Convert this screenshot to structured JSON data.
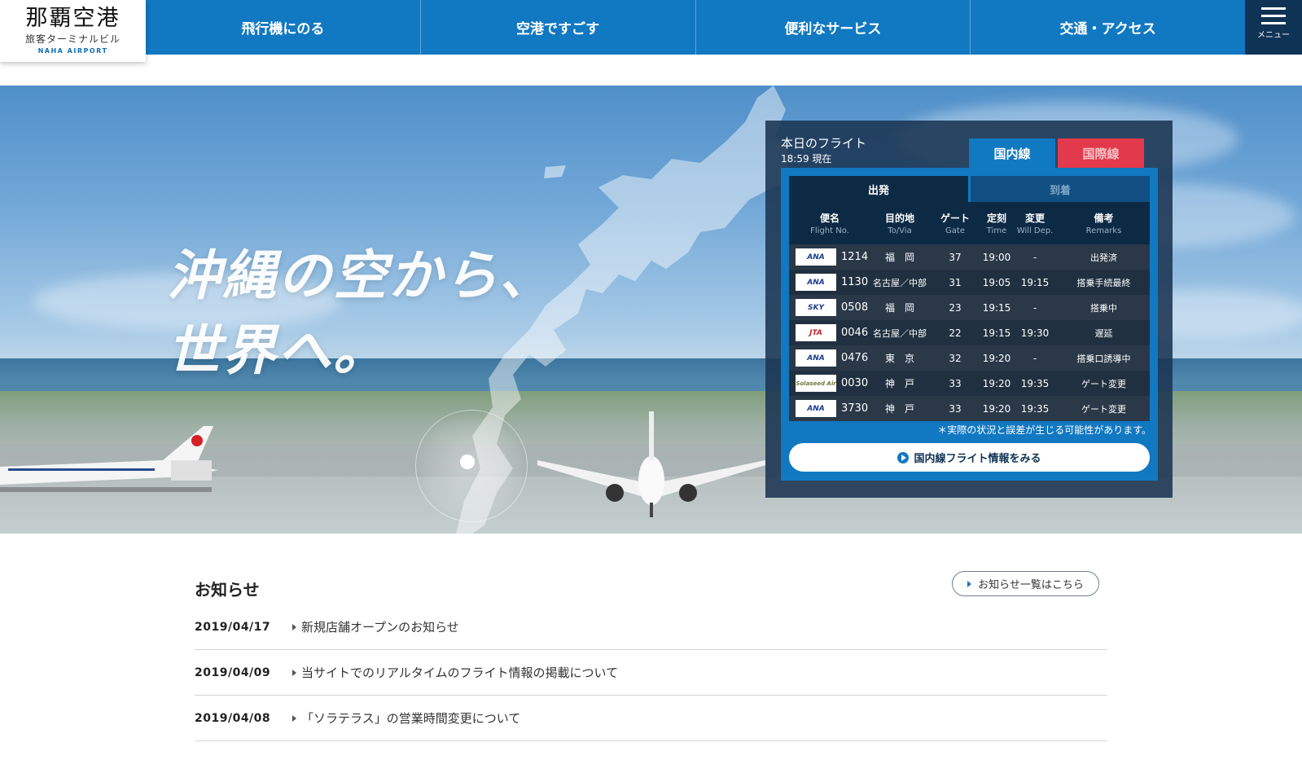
{
  "logo": {
    "main": "那覇空港",
    "sub": "旅客ターミナルビル",
    "en": "NAHA AIRPORT"
  },
  "nav": {
    "items": [
      {
        "label": "飛行機にのる"
      },
      {
        "label": "空港ですごす"
      },
      {
        "label": "便利なサービス"
      },
      {
        "label": "交通・アクセス"
      }
    ],
    "menu_label": "メニュー"
  },
  "hero": {
    "line1": "沖縄の空から、",
    "line2": "世界へ。"
  },
  "flights": {
    "title": "本日のフライト",
    "time": "18:59 現在",
    "tab_domestic": "国内線",
    "tab_international": "国際線",
    "dir_departure": "出発",
    "dir_arrival": "到着",
    "headers": [
      {
        "jp": "便名",
        "en": "Flight No."
      },
      {
        "jp": "目的地",
        "en": "To/Via"
      },
      {
        "jp": "ゲート",
        "en": "Gate"
      },
      {
        "jp": "定刻",
        "en": "Time"
      },
      {
        "jp": "変更",
        "en": "Will Dep."
      },
      {
        "jp": "備考",
        "en": "Remarks"
      }
    ],
    "rows": [
      {
        "airline": "ANA",
        "no": "1214",
        "dest": "福　岡",
        "gate": "37",
        "time": "19:00",
        "change": "-",
        "remarks": "出発済"
      },
      {
        "airline": "ANA",
        "no": "1130",
        "dest": "名古屋／中部",
        "gate": "31",
        "time": "19:05",
        "change": "19:15",
        "remarks": "搭乗手続最終"
      },
      {
        "airline": "SKY",
        "no": "0508",
        "dest": "福　岡",
        "gate": "23",
        "time": "19:15",
        "change": "-",
        "remarks": "搭乗中"
      },
      {
        "airline": "JTA",
        "no": "0046",
        "dest": "名古屋／中部",
        "gate": "22",
        "time": "19:15",
        "change": "19:30",
        "remarks": "遅延"
      },
      {
        "airline": "ANA",
        "no": "0476",
        "dest": "東　京",
        "gate": "32",
        "time": "19:20",
        "change": "-",
        "remarks": "搭乗口誘導中"
      },
      {
        "airline": "Solaseed Air",
        "no": "0030",
        "dest": "神　戸",
        "gate": "33",
        "time": "19:20",
        "change": "19:35",
        "remarks": "ゲート変更"
      },
      {
        "airline": "ANA",
        "no": "3730",
        "dest": "神　戸",
        "gate": "33",
        "time": "19:20",
        "change": "19:35",
        "remarks": "ゲート変更"
      }
    ],
    "note": "＊実際の状況と誤差が生じる可能性があります。",
    "button": "国内線フライト情報をみる"
  },
  "news": {
    "title": "お知らせ",
    "more": "お知らせ一覧はこちら",
    "items": [
      {
        "date": "2019/04/17",
        "text": "新規店舗オープンのお知らせ"
      },
      {
        "date": "2019/04/09",
        "text": "当サイトでのリアルタイムのフライト情報の掲載について"
      },
      {
        "date": "2019/04/08",
        "text": "「ソラテラス」の営業時間変更について"
      }
    ]
  },
  "colors": {
    "brand_blue": "#1178c2",
    "dark_navy": "#0f3354",
    "intl_red": "#e23a4c"
  }
}
